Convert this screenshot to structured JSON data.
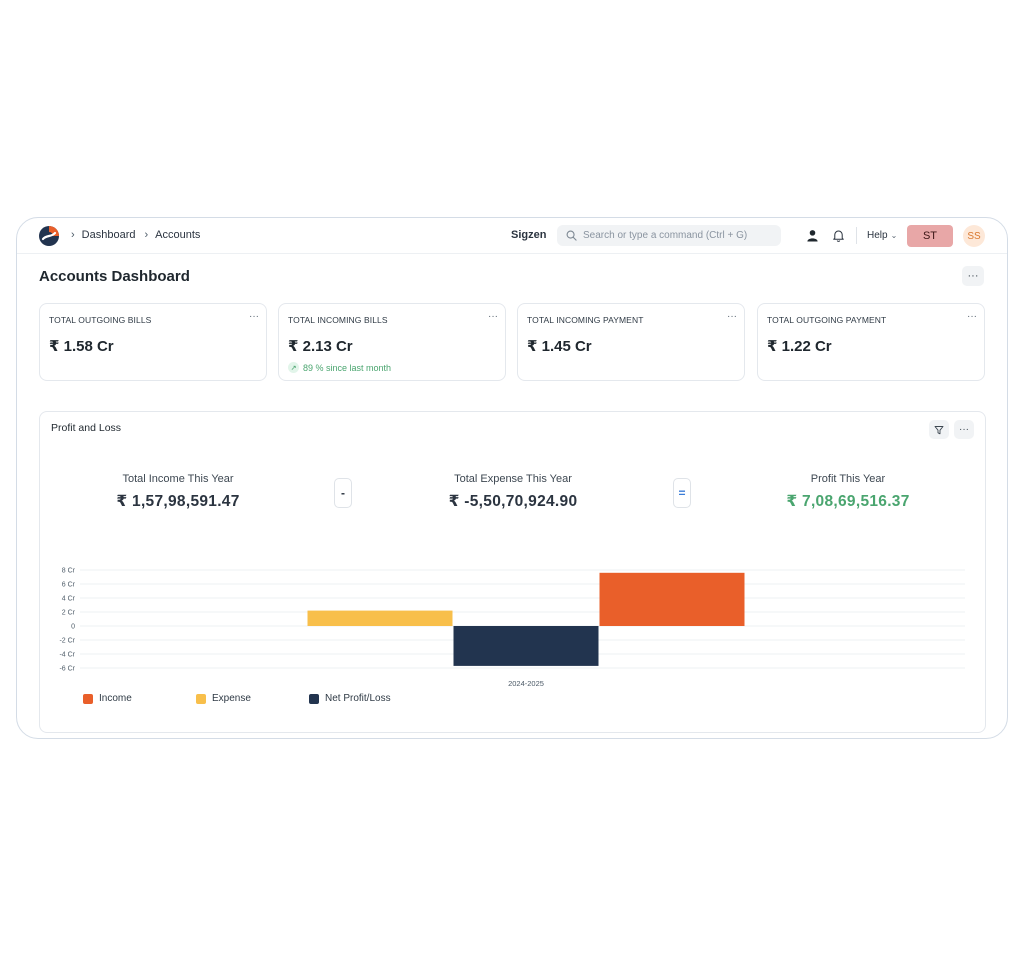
{
  "navbar": {
    "breadcrumbs": [
      "Dashboard",
      "Accounts"
    ],
    "org": "Sigzen",
    "search_placeholder": "Search or type a command (Ctrl + G)",
    "help_label": "Help",
    "st_label": "ST",
    "avatar_initials": "SS"
  },
  "page": {
    "title": "Accounts Dashboard",
    "more_label": "···"
  },
  "cards": [
    {
      "label": "TOTAL OUTGOING BILLS",
      "value": "₹ 1.58 Cr",
      "delta": ""
    },
    {
      "label": "TOTAL INCOMING BILLS",
      "value": "₹ 2.13 Cr",
      "delta": "89 % since last month"
    },
    {
      "label": "TOTAL INCOMING PAYMENT",
      "value": "₹ 1.45 Cr",
      "delta": ""
    },
    {
      "label": "TOTAL OUTGOING PAYMENT",
      "value": "₹ 1.22 Cr",
      "delta": ""
    }
  ],
  "widget": {
    "title": "Profit and Loss",
    "income_label": "Total Income This Year",
    "income_value": "₹ 1,57,98,591.47",
    "minus_op": "-",
    "expense_label": "Total Expense This Year",
    "expense_value": "₹ -5,50,70,924.90",
    "equals_op": "=",
    "profit_label": "Profit This Year",
    "profit_value": "₹ 7,08,69,516.37"
  },
  "colors": {
    "income": "#e95f2a",
    "expense": "#f8bf4b",
    "net": "#22344f",
    "positive": "#4aa56f"
  },
  "chart_data": {
    "type": "bar",
    "categories": [
      "2024-2025"
    ],
    "series": [
      {
        "name": "Income",
        "values": [
          7.6
        ]
      },
      {
        "name": "Expense",
        "values": [
          2.2
        ]
      },
      {
        "name": "Net Profit/Loss",
        "values": [
          -5.7
        ]
      }
    ],
    "y_ticks": [
      "8 Cr",
      "6 Cr",
      "4 Cr",
      "2 Cr",
      "0",
      "-2 Cr",
      "-4 Cr",
      "-6 Cr"
    ],
    "ylim": [
      -6,
      8
    ],
    "grid": true,
    "legend_position": "bottom-left"
  }
}
